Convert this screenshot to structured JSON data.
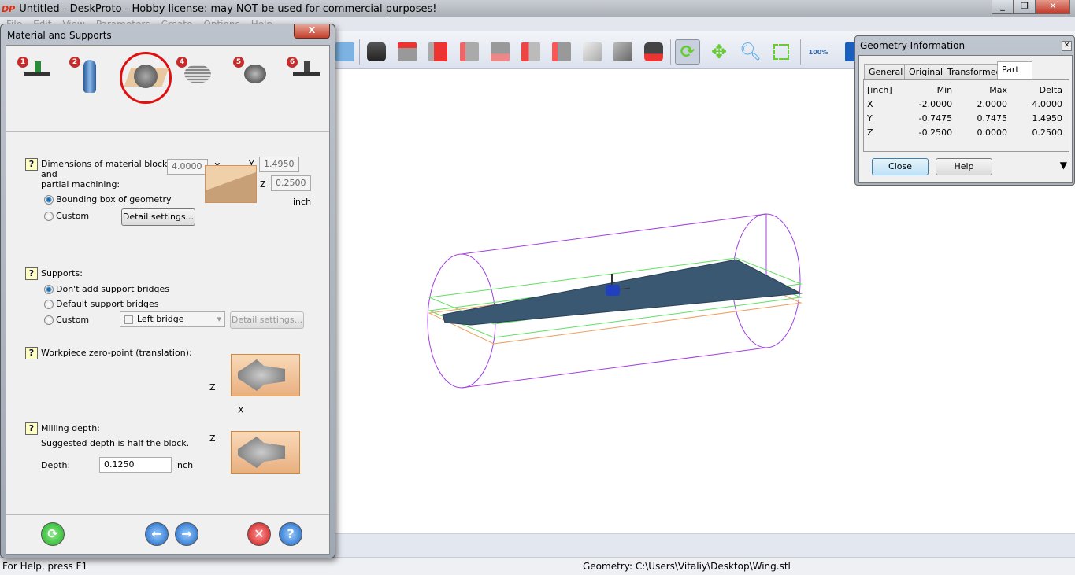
{
  "window": {
    "logo": "DP",
    "title": "Untitled - DeskProto - Hobby license: may NOT be used for commercial purposes!"
  },
  "menu": [
    "File",
    "Edit",
    "View",
    "Parameters",
    "Create",
    "Options",
    "Help"
  ],
  "toolbar": [
    "view-list-icon",
    "screenshot-icon",
    "view-top-icon",
    "view-front-icon",
    "view-left-icon",
    "view-back-icon",
    "view-right-icon",
    "view-bottom-icon",
    "view-iso-icon",
    "view-shaded-icon",
    "camera-undo-icon",
    "rotate-icon",
    "pan-icon",
    "zoom-in-out-icon",
    "zoom-window-icon",
    "zoom-100-icon",
    "help-book-icon"
  ],
  "dialog": {
    "title": "Material and Supports",
    "close": "X",
    "steps": [
      "1",
      "2",
      "3",
      "4",
      "5",
      "6"
    ],
    "selected_step": 3,
    "dimensions": {
      "label1": "Dimensions of material block",
      "label2": "and",
      "label3": "partial machining:",
      "x": "4.0000",
      "y": "1.4950",
      "z": "0.2500",
      "x_label": "X",
      "y_label": "Y",
      "z_label": "Z",
      "unit": "inch",
      "opt_bbox": "Bounding box of geometry",
      "opt_custom": "Custom",
      "detail": "Detail settings..."
    },
    "supports": {
      "label": "Supports:",
      "opt1": "Don't add support bridges",
      "opt2": "Default support bridges",
      "opt3": "Custom",
      "bridge": "Left bridge",
      "detail": "Detail settings..."
    },
    "zero": {
      "label": "Workpiece zero-point (translation):",
      "z": "Z",
      "x": "X"
    },
    "depth": {
      "label": "Milling depth:",
      "hint": "Suggested depth is half the block.",
      "depth_label": "Depth:",
      "value": "0.1250",
      "unit": "inch",
      "z": "Z"
    },
    "help_mark": "?"
  },
  "geometry_info": {
    "title": "Geometry Information",
    "tabs": [
      "General",
      "Original",
      "Transformed",
      "Part"
    ],
    "active_tab": "Part",
    "headers": [
      "[inch]",
      "Min",
      "Max",
      "Delta"
    ],
    "rows": [
      [
        "X",
        "-2.0000",
        "2.0000",
        "4.0000"
      ],
      [
        "Y",
        "-0.7475",
        "0.7475",
        "1.4950"
      ],
      [
        "Z",
        "-0.2500",
        "0.0000",
        "0.2500"
      ]
    ],
    "close": "Close",
    "help": "Help"
  },
  "status": {
    "help": "For Help, press F1",
    "geometry": "Geometry: C:\\Users\\Vitaliy\\Desktop\\Wing.stl"
  }
}
